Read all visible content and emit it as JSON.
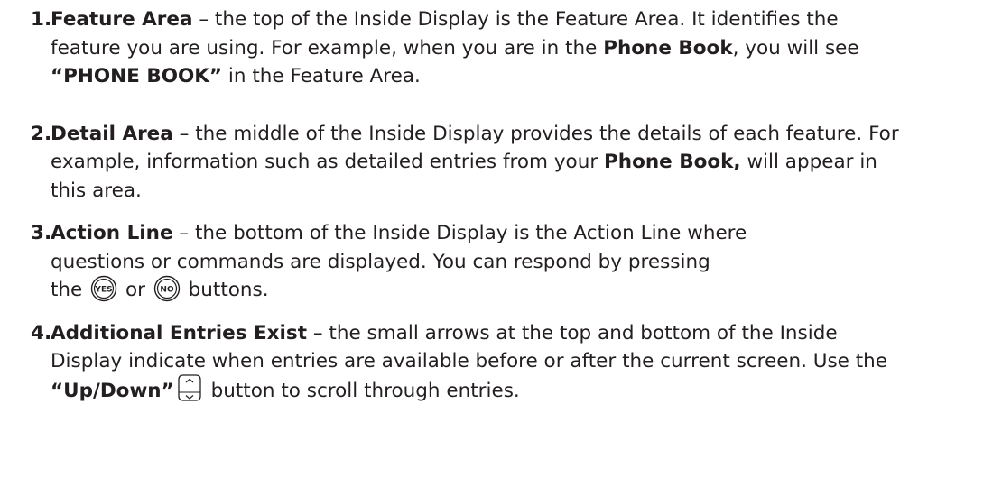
{
  "items": [
    {
      "number": "1.",
      "term": "Feature Area",
      "line1": " – the top of the Inside Display is the Feature Area. It identifies the",
      "line2a": "feature you are using. For example, when you are in the ",
      "line2b": "Phone Book",
      "line2c": ", you will see",
      "line3a": "“PHONE BOOK”",
      "line3b": " in the Feature Area."
    },
    {
      "number": "2.",
      "term": "Detail Area",
      "line1": " – the middle of the Inside Display provides the details of each feature. For",
      "line2a": "example, information such as detailed entries from your ",
      "line2b": "Phone Book,",
      "line2c": " will appear in",
      "line3": "this area."
    },
    {
      "number": "3.",
      "term": "Action Line",
      "line1": " – the bottom of the Inside Display is the Action Line where",
      "line2": "questions or commands are displayed. You can respond by pressing",
      "line3a": "the ",
      "line3b": " or ",
      "line3c": " buttons.",
      "yes_label": "YES",
      "no_label": "NO"
    },
    {
      "number": "4.",
      "term": "Additional Entries Exist",
      "line1": " – the small arrows at the top and bottom of the Inside",
      "line2": "Display indicate when entries are available before or after the current screen. Use the",
      "line3a": "“Up/Down”",
      "line3b": " button to scroll through entries."
    }
  ],
  "icons": {
    "yes": "yes-button-icon",
    "no": "no-button-icon",
    "updown": "up-down-button-icon"
  }
}
